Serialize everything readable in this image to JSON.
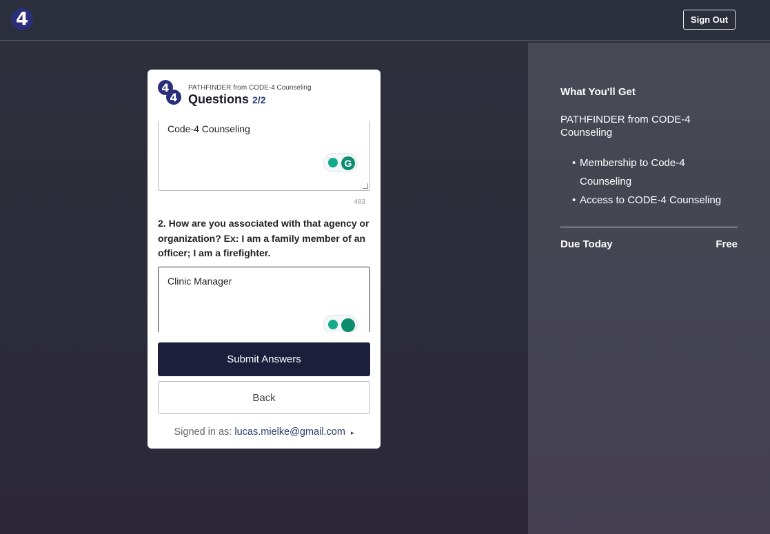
{
  "header": {
    "logo_text": "4",
    "signout_label": "Sign Out"
  },
  "card": {
    "logo_text": "4",
    "subtitle": "PATHFINDER from CODE-4 Counseling",
    "title": "Questions",
    "step": "2/2",
    "answer1": "Code-4 Counseling",
    "answer1_counter": "483",
    "question2": "2. How are you associated with that agency or organization? Ex: I am a family member of an officer; I am a firefighter.",
    "answer2": "Clinic Manager",
    "submit_label": "Submit Answers",
    "back_label": "Back",
    "signed_in_prefix": "Signed in as:",
    "signed_in_email": "lucas.mielke@gmail.com",
    "caret_icon": "▸"
  },
  "sidebar": {
    "title": "What You'll Get",
    "product": "PATHFINDER from CODE-4 Counseling",
    "items": [
      "Membership to Code-4 Counseling",
      "Access to CODE-4 Counseling"
    ],
    "due_label": "Due Today",
    "due_value": "Free"
  },
  "colors": {
    "accent": "#1b1f3b",
    "logo": "#2a2f7a",
    "grammarly": "#14a88d"
  }
}
